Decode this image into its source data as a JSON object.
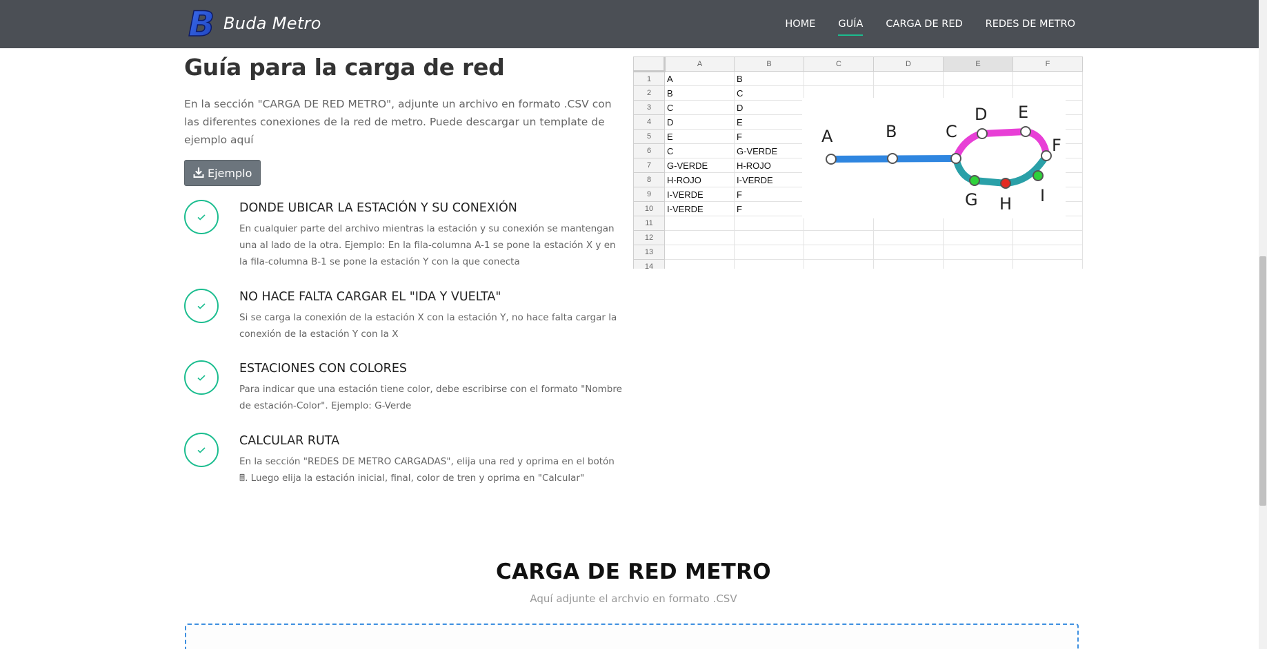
{
  "header": {
    "brand_letter": "B",
    "brand_name": "Buda Metro",
    "nav": [
      {
        "label": "HOME",
        "active": false
      },
      {
        "label": "GUÍA",
        "active": true
      },
      {
        "label": "CARGA DE RED",
        "active": false
      },
      {
        "label": "REDES DE METRO",
        "active": false
      }
    ]
  },
  "guide": {
    "title": "Guía para la carga de red",
    "intro": "En la sección \"CARGA DE RED METRO\", adjunte un archivo en formato .CSV con las diferentes conexiones de la red de metro. Puede descargar un template de ejemplo aquí",
    "example_button": "Ejemplo",
    "example_icon": "download-icon",
    "steps": [
      {
        "title": "DONDE UBICAR LA ESTACIÓN Y SU CONEXIÓN",
        "text": "En cualquier parte del archivo mientras la estación y su conexión se mantengan una al lado de la otra. Ejemplo: En la fila-columna A-1 se pone la estación X y en la fila-columna B-1 se pone la estación Y con la que conecta",
        "icon": "check-icon"
      },
      {
        "title": "NO HACE FALTA CARGAR EL \"IDA Y VUELTA\"",
        "text": "Si se carga la conexión de la estación X con la estación Y, no hace falta cargar la conexión de la estación Y con la X",
        "icon": "check-icon"
      },
      {
        "title": "ESTACIONES CON COLORES",
        "text": "Para indicar que una estación tiene color, debe escribirse con el formato \"Nombre de estación-Color\". Ejemplo: G-Verde",
        "icon": "check-icon"
      },
      {
        "title": "CALCULAR RUTA",
        "text": "En la sección \"REDES DE METRO CARGADAS\", elija una red y oprima en el botón 🖩. Luego elija la estación inicial, final, color de tren y oprima en \"Calcular\"",
        "icon": "check-icon"
      }
    ]
  },
  "sheet": {
    "columns": [
      "A",
      "B",
      "C",
      "D",
      "E",
      "F"
    ],
    "selected_column": "E",
    "rows": [
      [
        "1",
        "A",
        "B"
      ],
      [
        "2",
        "B",
        "C"
      ],
      [
        "3",
        "C",
        "D"
      ],
      [
        "4",
        "D",
        "E"
      ],
      [
        "5",
        "E",
        "F"
      ],
      [
        "6",
        "C",
        "G-VERDE"
      ],
      [
        "7",
        "G-VERDE",
        "H-ROJO"
      ],
      [
        "8",
        "H-ROJO",
        "I-VERDE"
      ],
      [
        "9",
        "I-VERDE",
        "F"
      ],
      [
        "10",
        "I-VERDE",
        "F"
      ],
      [
        "11",
        "",
        ""
      ],
      [
        "12",
        "",
        ""
      ],
      [
        "13",
        "",
        ""
      ],
      [
        "14",
        "",
        ""
      ]
    ],
    "diagram_labels": [
      "A",
      "B",
      "C",
      "D",
      "E",
      "F",
      "G",
      "H",
      "I"
    ],
    "colors": {
      "blue_line": "#2f86e0",
      "pink_line": "#e83fd6",
      "teal_line": "#2aa0a8",
      "green_station": "#2fd23a",
      "red_station": "#e52a22"
    }
  },
  "upload": {
    "title": "CARGA DE RED METRO",
    "subtitle": "Aquí adjunte el archvio en formato .CSV"
  },
  "colors": {
    "header_bg": "#4b4f55",
    "accent": "#1bbd8f",
    "button_bg": "#6c757d",
    "dropzone_border": "#3d8fe0"
  }
}
